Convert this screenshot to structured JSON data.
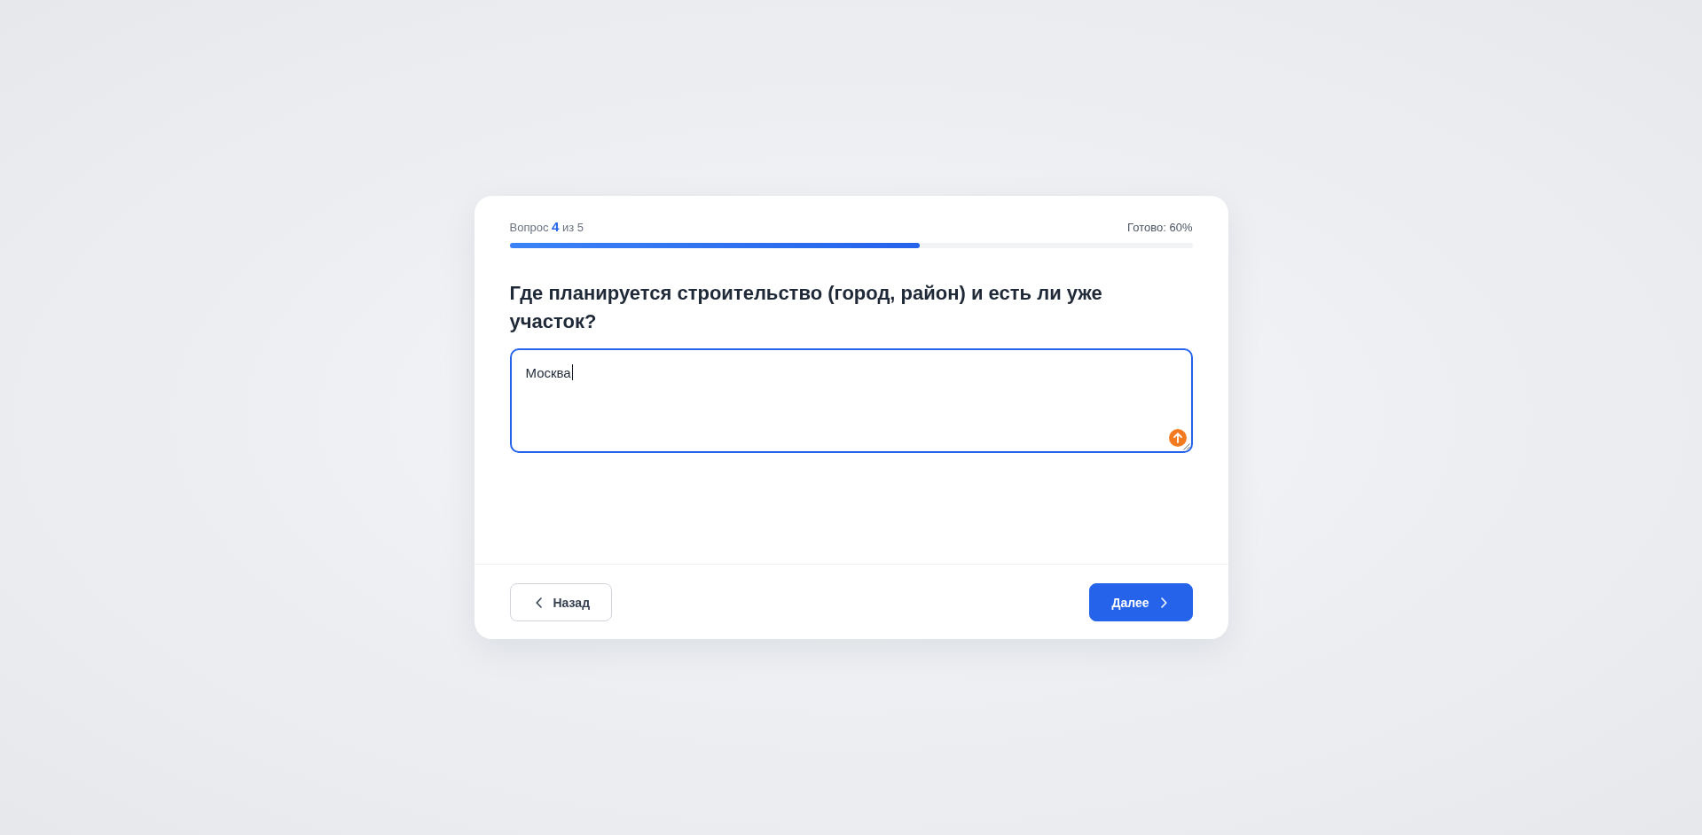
{
  "progress": {
    "counter": "Вопрос **4** из 5",
    "done_label": "Готово: 60%",
    "level": 0.6
  },
  "question": {
    "title": "Где планируется строительство (город, район) и есть ли уже участок?",
    "answer": {
      "value": "Москва",
      "focused": true
    }
  },
  "footer": {
    "buttons": [
      {
        "kind": "back",
        "label": "Назад"
      },
      {
        "kind": "next",
        "label": "Далее"
      }
    ]
  }
}
